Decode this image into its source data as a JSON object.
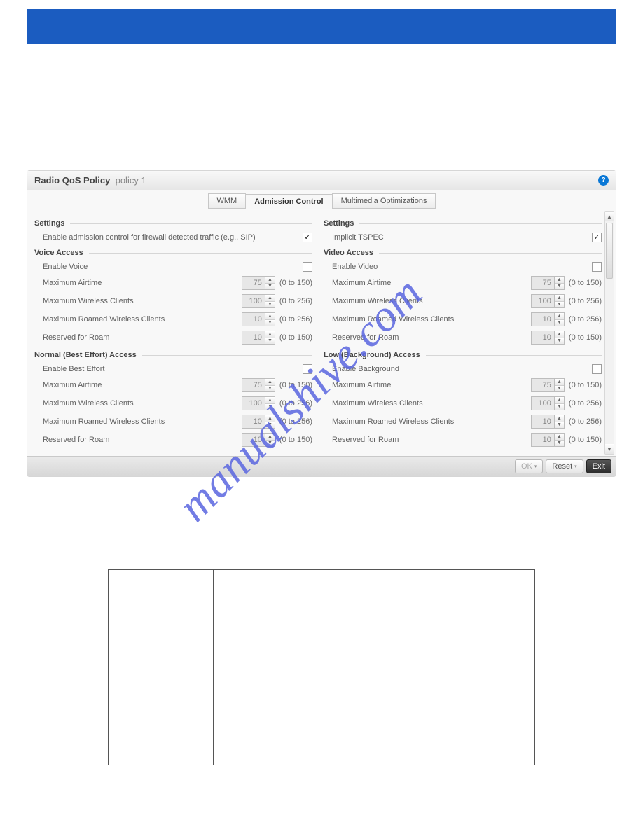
{
  "header": {
    "title_bold": "Radio QoS Policy",
    "title_sub": "policy 1"
  },
  "tabs": {
    "wmm": "WMM",
    "admission": "Admission Control",
    "multimedia": "Multimedia Optimizations"
  },
  "left": {
    "settings_head": "Settings",
    "enable_admission_label": "Enable admission control for firewall detected traffic (e.g., SIP)",
    "voice_head": "Voice Access",
    "enable_voice_label": "Enable Voice",
    "normal_head": "Normal (Best Effort) Access",
    "enable_be_label": "Enable Best Effort"
  },
  "right": {
    "settings_head": "Settings",
    "implicit_tspec_label": "Implicit TSPEC",
    "video_head": "Video Access",
    "enable_video_label": "Enable Video",
    "low_head": "Low (Background) Access",
    "enable_bg_label": "Enable Background"
  },
  "rows": {
    "max_airtime": "Maximum Airtime",
    "max_wc": "Maximum Wireless Clients",
    "max_rwc": "Maximum Roamed Wireless Clients",
    "reserved_roam": "Reserved for Roam"
  },
  "values": {
    "airtime": "75",
    "wc": "100",
    "rwc": "10",
    "roam": "10"
  },
  "hints": {
    "h150": "(0 to 150)",
    "h256": "(0 to 256)"
  },
  "footer": {
    "ok": "OK",
    "reset": "Reset",
    "exit": "Exit"
  },
  "watermark": "manualshive.com",
  "table": {
    "r1c1": "",
    "r1c2": "",
    "r2c1": "",
    "r2c2": ""
  }
}
